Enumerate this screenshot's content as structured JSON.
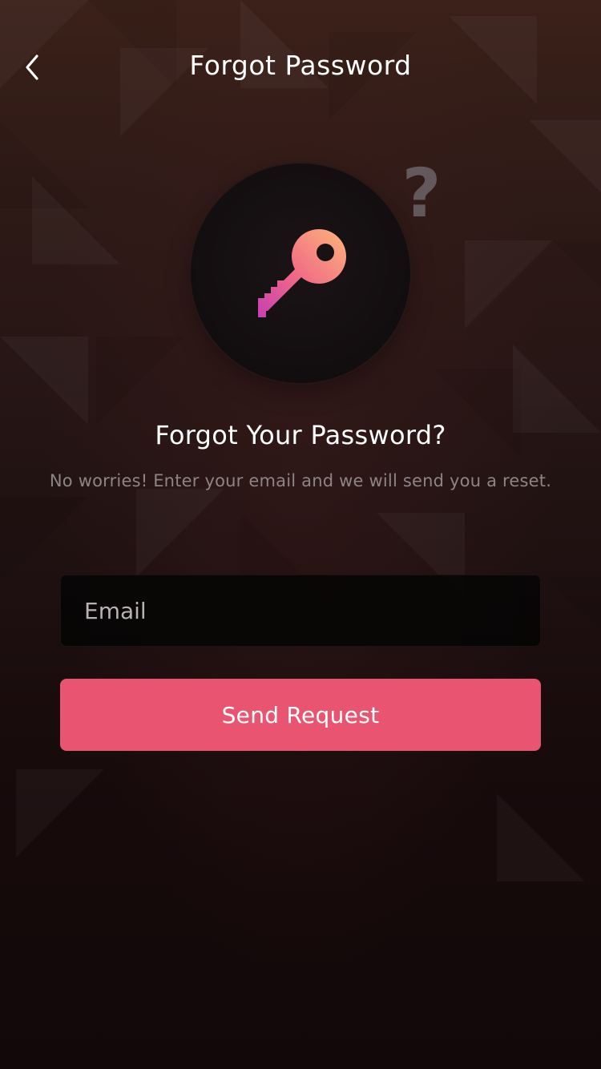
{
  "header": {
    "title": "Forgot Password",
    "back_icon": "chevron-left-icon"
  },
  "illustration": {
    "key_icon": "key-icon",
    "help_icon": "question-mark-icon",
    "help_glyph": "?"
  },
  "content": {
    "heading": "Forgot Your Password?",
    "subtext": "No worries! Enter your email and we will send you a reset."
  },
  "form": {
    "email_placeholder": "Email",
    "email_value": "",
    "submit_label": "Send Request"
  },
  "colors": {
    "accent": "#e95571",
    "key_gradient_start": "#ffb57a",
    "key_gradient_end": "#c63fb2"
  }
}
